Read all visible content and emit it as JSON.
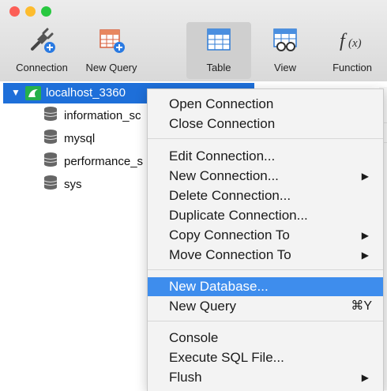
{
  "window": {
    "traffic_lights": [
      "#fc5f57",
      "#fdbc2e",
      "#28c840"
    ]
  },
  "toolbar": {
    "items": [
      {
        "label": "Connection",
        "icon": "plug-add-icon"
      },
      {
        "label": "New Query",
        "icon": "table-add-icon"
      },
      {
        "label": "Table",
        "icon": "table-icon",
        "active": true
      },
      {
        "label": "View",
        "icon": "view-icon"
      },
      {
        "label": "Function",
        "icon": "function-icon"
      }
    ]
  },
  "sidebar": {
    "connection": {
      "label": "localhost_3360",
      "icon": "mysql-dolphin-icon"
    },
    "databases": [
      "information_sc",
      "mysql",
      "performance_s",
      "sys"
    ]
  },
  "context_menu": {
    "groups": [
      [
        {
          "label": "Open Connection"
        },
        {
          "label": "Close Connection"
        }
      ],
      [
        {
          "label": "Edit Connection..."
        },
        {
          "label": "New Connection...",
          "submenu": true
        },
        {
          "label": "Delete Connection..."
        },
        {
          "label": "Duplicate Connection..."
        },
        {
          "label": "Copy Connection To",
          "submenu": true
        },
        {
          "label": "Move Connection To",
          "submenu": true
        }
      ],
      [
        {
          "label": "New Database...",
          "highlighted": true
        },
        {
          "label": "New Query",
          "shortcut": "⌘Y"
        }
      ],
      [
        {
          "label": "Console"
        },
        {
          "label": "Execute SQL File..."
        },
        {
          "label": "Flush",
          "submenu": true
        }
      ]
    ],
    "submenu_arrow": "▶"
  },
  "colors": {
    "selection_blue": "#1e6fd9",
    "menu_highlight": "#3e8ded"
  }
}
